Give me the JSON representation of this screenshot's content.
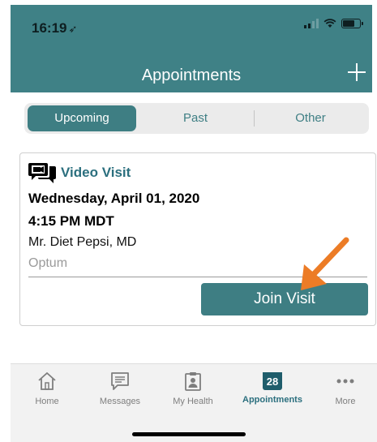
{
  "status_bar": {
    "time": "16:19"
  },
  "header": {
    "title": "Appointments"
  },
  "segments": {
    "upcoming": "Upcoming",
    "past": "Past",
    "other": "Other",
    "selected": "Upcoming"
  },
  "appointment": {
    "visit_type": "Video Visit",
    "date": "Wednesday, April 01, 2020",
    "time": "4:15 PM MDT",
    "provider": "Mr. Diet Pepsi, MD",
    "organization": "Optum",
    "join_label": "Join Visit"
  },
  "tabbar": {
    "items": [
      {
        "label": "Home",
        "icon": "home-icon"
      },
      {
        "label": "Messages",
        "icon": "messages-icon"
      },
      {
        "label": "My Health",
        "icon": "clipboard-icon"
      },
      {
        "label": "Appointments",
        "icon": "calendar-icon",
        "badge": "28",
        "selected": true
      },
      {
        "label": "More",
        "icon": "more-icon"
      }
    ]
  },
  "colors": {
    "brand_teal": "#3f8186",
    "accent_orange": "#ec7c26",
    "text_teal": "#2b6f7e"
  }
}
